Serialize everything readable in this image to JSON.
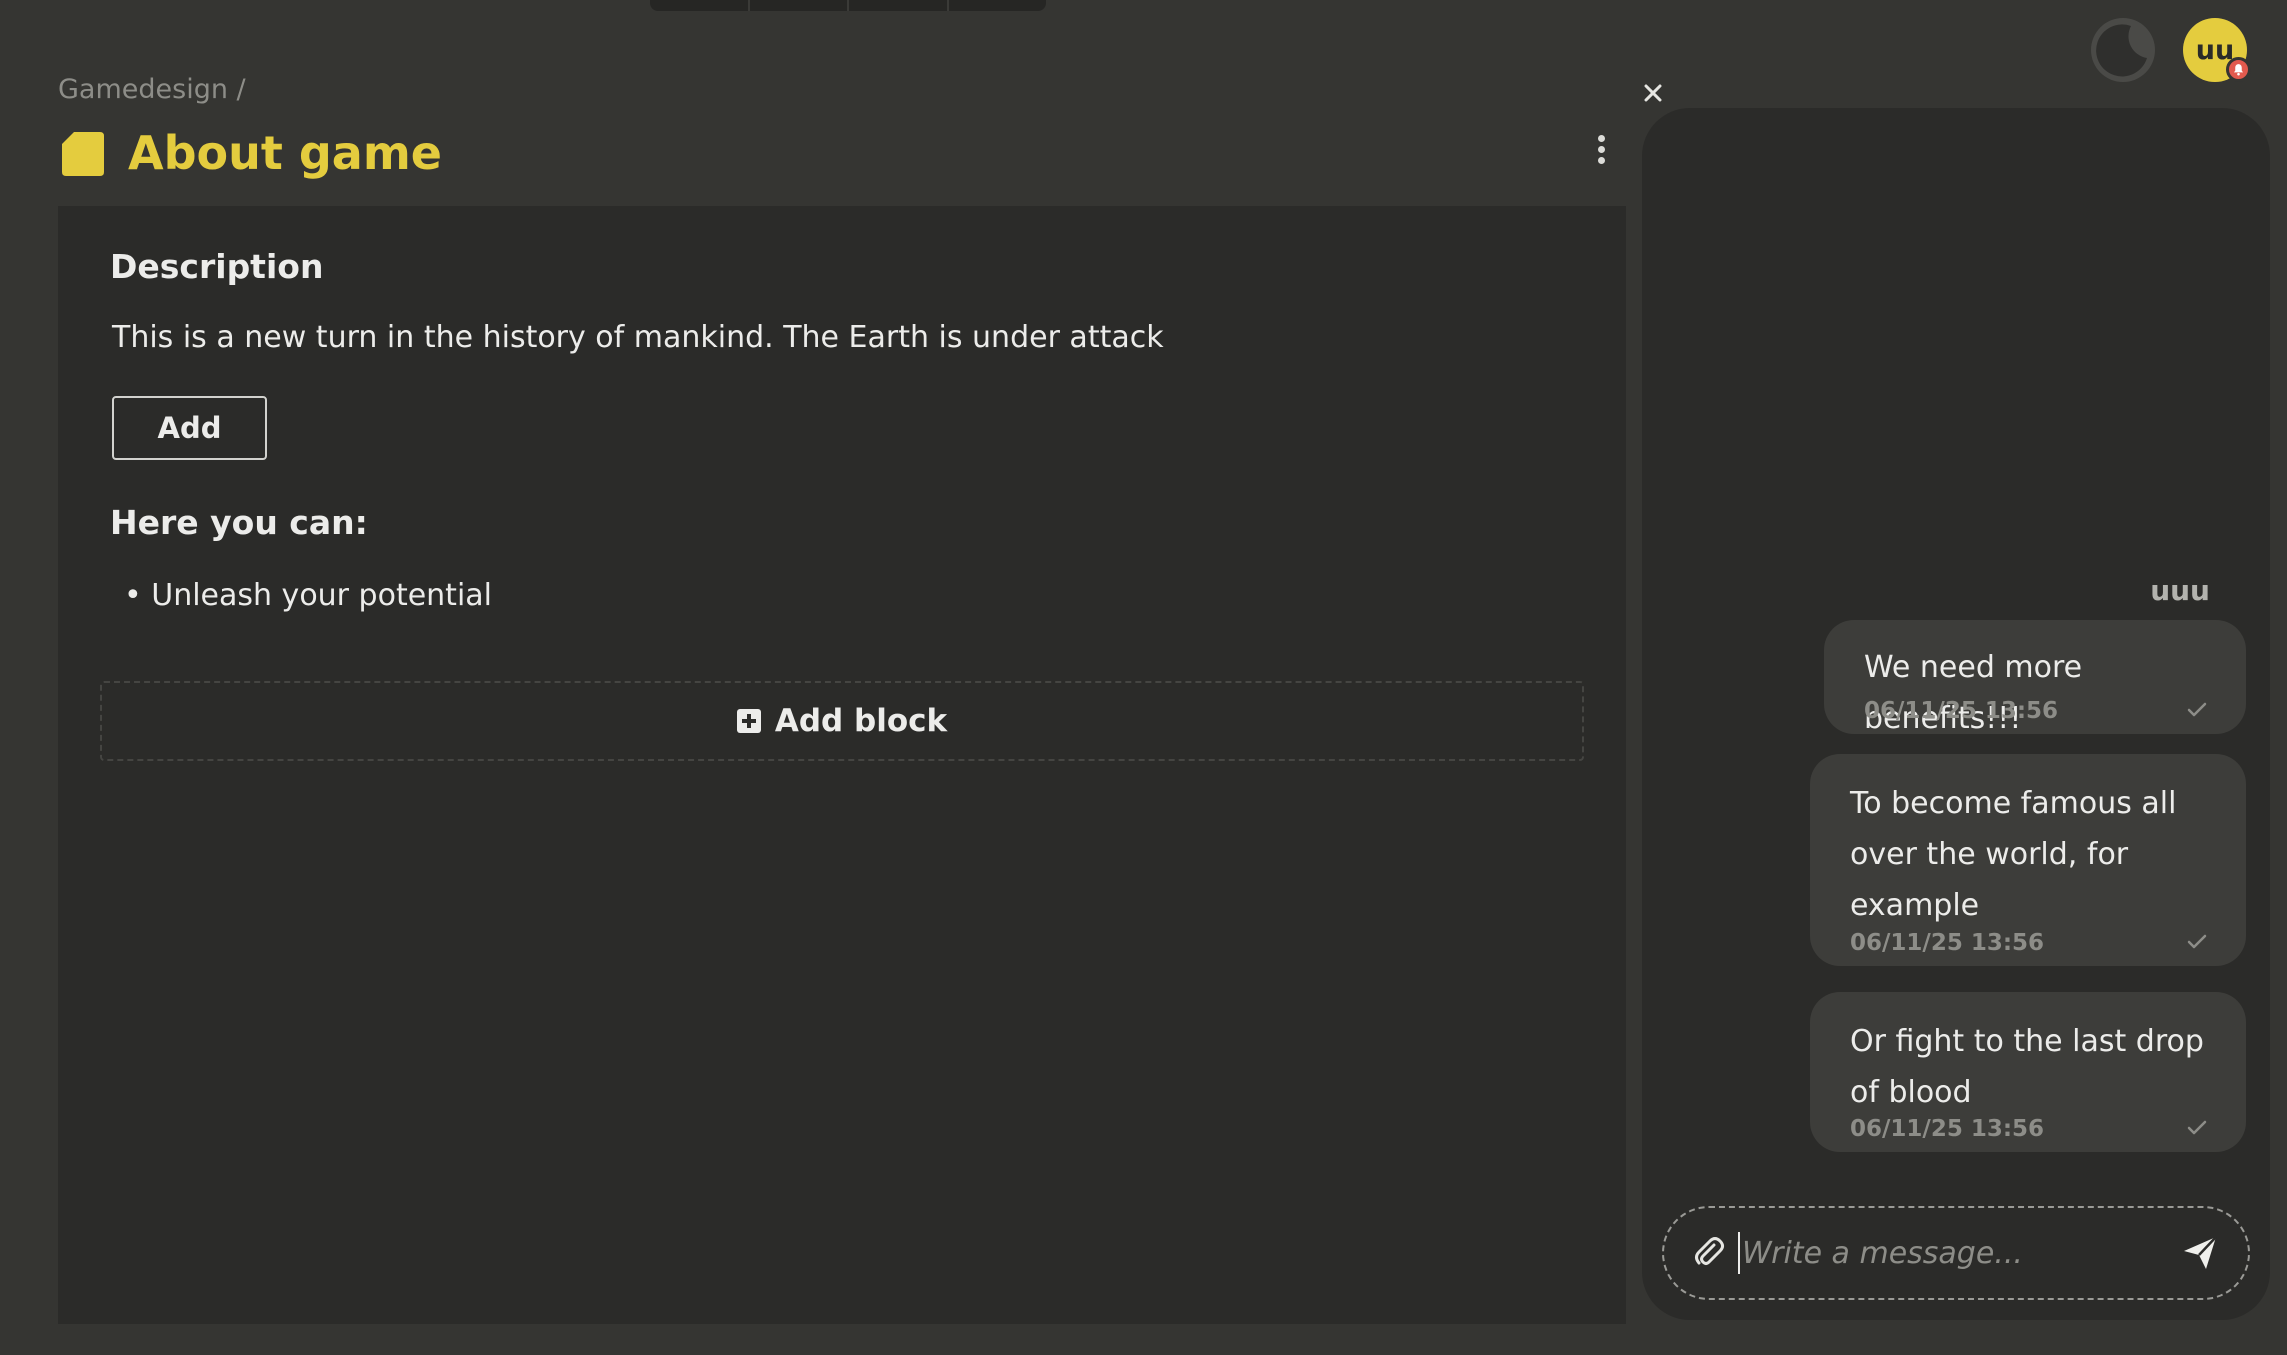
{
  "header": {
    "breadcrumb": "Gamedesign /",
    "title": "About game",
    "avatar_initials": "uu",
    "accent_color": "#e4cc3e",
    "badge_color": "#e25a4e"
  },
  "content": {
    "description_heading": "Description",
    "description_text": "This is a new turn in the history of mankind. The Earth is under attack",
    "add_button_label": "Add",
    "list_heading": "Here you can:",
    "list_items": [
      "• Unleash your potential"
    ],
    "add_block_label": "Add block"
  },
  "chat": {
    "author": "uuu",
    "messages": [
      {
        "text": "We need more benefits!!!",
        "time": "06/11/25 13:56"
      },
      {
        "text": "To become famous all over the world, for example",
        "time": "06/11/25 13:56"
      },
      {
        "text": "Or fight to the last drop of blood",
        "time": "06/11/25 13:56"
      }
    ],
    "input_placeholder": "Write a message..."
  }
}
